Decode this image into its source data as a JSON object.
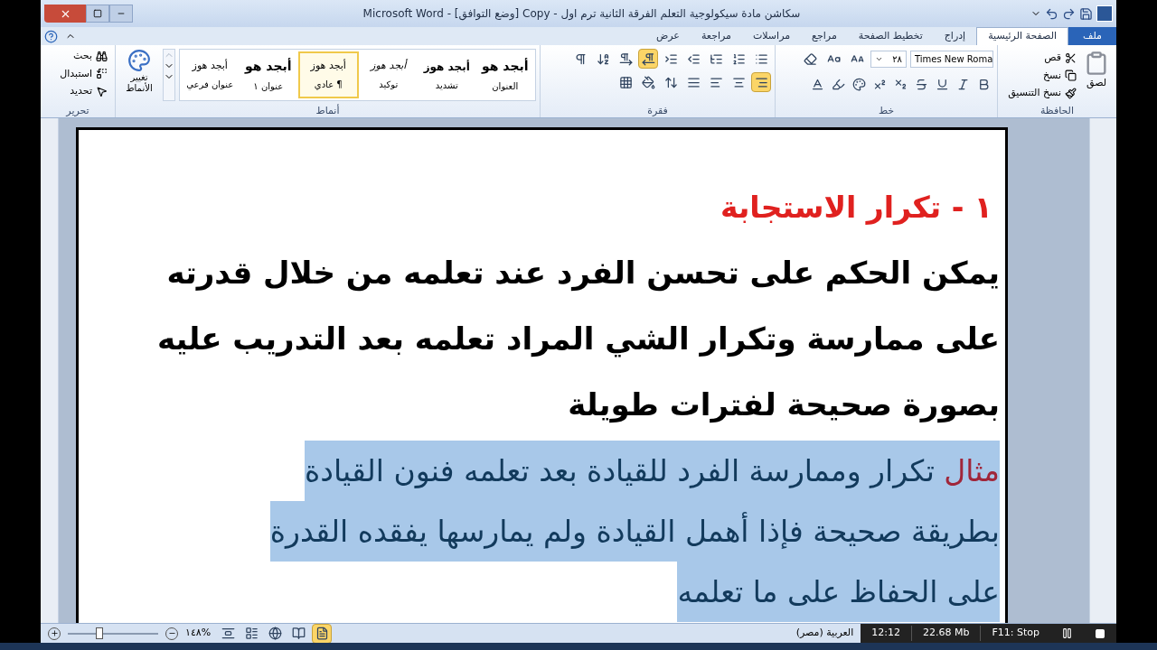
{
  "window": {
    "title": "سكاشن مادة سيكولوجية التعلم الفرقة الثانية ترم اول - Copy [وضع التوافق] - Microsoft Word"
  },
  "tabs": [
    {
      "label": "ملف",
      "kind": "file",
      "selected": false
    },
    {
      "label": "الصفحة الرئيسية",
      "kind": "tab",
      "selected": true
    },
    {
      "label": "إدراج",
      "kind": "tab",
      "selected": false
    },
    {
      "label": "تخطيط الصفحة",
      "kind": "tab",
      "selected": false
    },
    {
      "label": "مراجع",
      "kind": "tab",
      "selected": false
    },
    {
      "label": "مراسلات",
      "kind": "tab",
      "selected": false
    },
    {
      "label": "مراجعة",
      "kind": "tab",
      "selected": false
    },
    {
      "label": "عرض",
      "kind": "tab",
      "selected": false
    }
  ],
  "ribbon": {
    "clipboard": {
      "label": "الحافظة",
      "paste": "لصق",
      "cut": "قص",
      "copy": "نسخ",
      "format_painter": "نسخ التنسيق"
    },
    "font": {
      "label": "خط",
      "name": "Times New Roma",
      "size": "٢٨"
    },
    "paragraph": {
      "label": "فقرة",
      "row_1": [
        {
          "kind": "bullets",
          "selected": false
        },
        {
          "kind": "numbering",
          "selected": false
        },
        {
          "kind": "multilevel",
          "selected": false
        },
        {
          "kind": "outdent",
          "selected": false
        },
        {
          "kind": "indent",
          "selected": false
        },
        {
          "kind": "rtl",
          "selected": true
        },
        {
          "kind": "ltr",
          "selected": false
        },
        {
          "kind": "sort",
          "selected": false
        },
        {
          "kind": "marks",
          "selected": false
        }
      ],
      "row_2": [
        {
          "kind": "align-right",
          "selected": true
        },
        {
          "kind": "align-center",
          "selected": false
        },
        {
          "kind": "align-left",
          "selected": false
        },
        {
          "kind": "justify",
          "selected": false
        },
        {
          "kind": "spacing",
          "selected": false
        },
        {
          "kind": "shading",
          "selected": false
        },
        {
          "kind": "borders",
          "selected": false
        }
      ]
    },
    "styles": {
      "label": "أنماط",
      "change": "تغيير الأنماط",
      "items": [
        {
          "sample": "أبجد هو",
          "name": "العنوان",
          "kind": "title",
          "selected": false
        },
        {
          "sample": "أبجد هوز",
          "name": "تشديد",
          "kind": "strong",
          "selected": false
        },
        {
          "sample": "أبجد هوز",
          "name": "توكيد",
          "kind": "emphasis",
          "selected": false
        },
        {
          "sample": "أبجد هوز",
          "name": "¶ عادي",
          "kind": "normal",
          "selected": true
        },
        {
          "sample": "أبجد هو",
          "name": "عنوان ١",
          "kind": "title",
          "selected": false
        },
        {
          "sample": "أبجد هوز",
          "name": "عنوان فرعي",
          "kind": "normal",
          "selected": false
        }
      ]
    },
    "editing": {
      "label": "تحرير",
      "find": "بحث",
      "replace": "استبدال",
      "select": "تحديد"
    }
  },
  "document": {
    "heading": "١ -  تكرار الاستجابة",
    "lines": [
      "يمكن الحكم على تحسن الفرد عند تعلمه من خلال قدرته",
      "على ممارسة وتكرار الشي المراد تعلمه بعد التدريب عليه",
      "بصورة صحيحة لفترات طويلة"
    ],
    "example": {
      "selected": true,
      "label": "مثال",
      "lines": [
        "تكرار وممارسة الفرد للقيادة بعد تعلمه فنون القيادة",
        "بطريقة صحيحة فإذا أهمل القيادة ولم يمارسها يفقده القدرة",
        "على الحفاظ على ما تعلمه"
      ]
    }
  },
  "status_bar": {
    "zoom": {
      "percent": "%١٤٨",
      "level": 0.35
    },
    "views": [
      {
        "kind": "draft",
        "selected": false
      },
      {
        "kind": "outline",
        "selected": false
      },
      {
        "kind": "web",
        "selected": false
      },
      {
        "kind": "reading",
        "selected": false
      },
      {
        "kind": "print",
        "selected": true
      }
    ],
    "language": "العربية (مصر)"
  },
  "recorder": {
    "time": "12:12",
    "size": "22.68 Mb",
    "stop": "F11: Stop"
  }
}
